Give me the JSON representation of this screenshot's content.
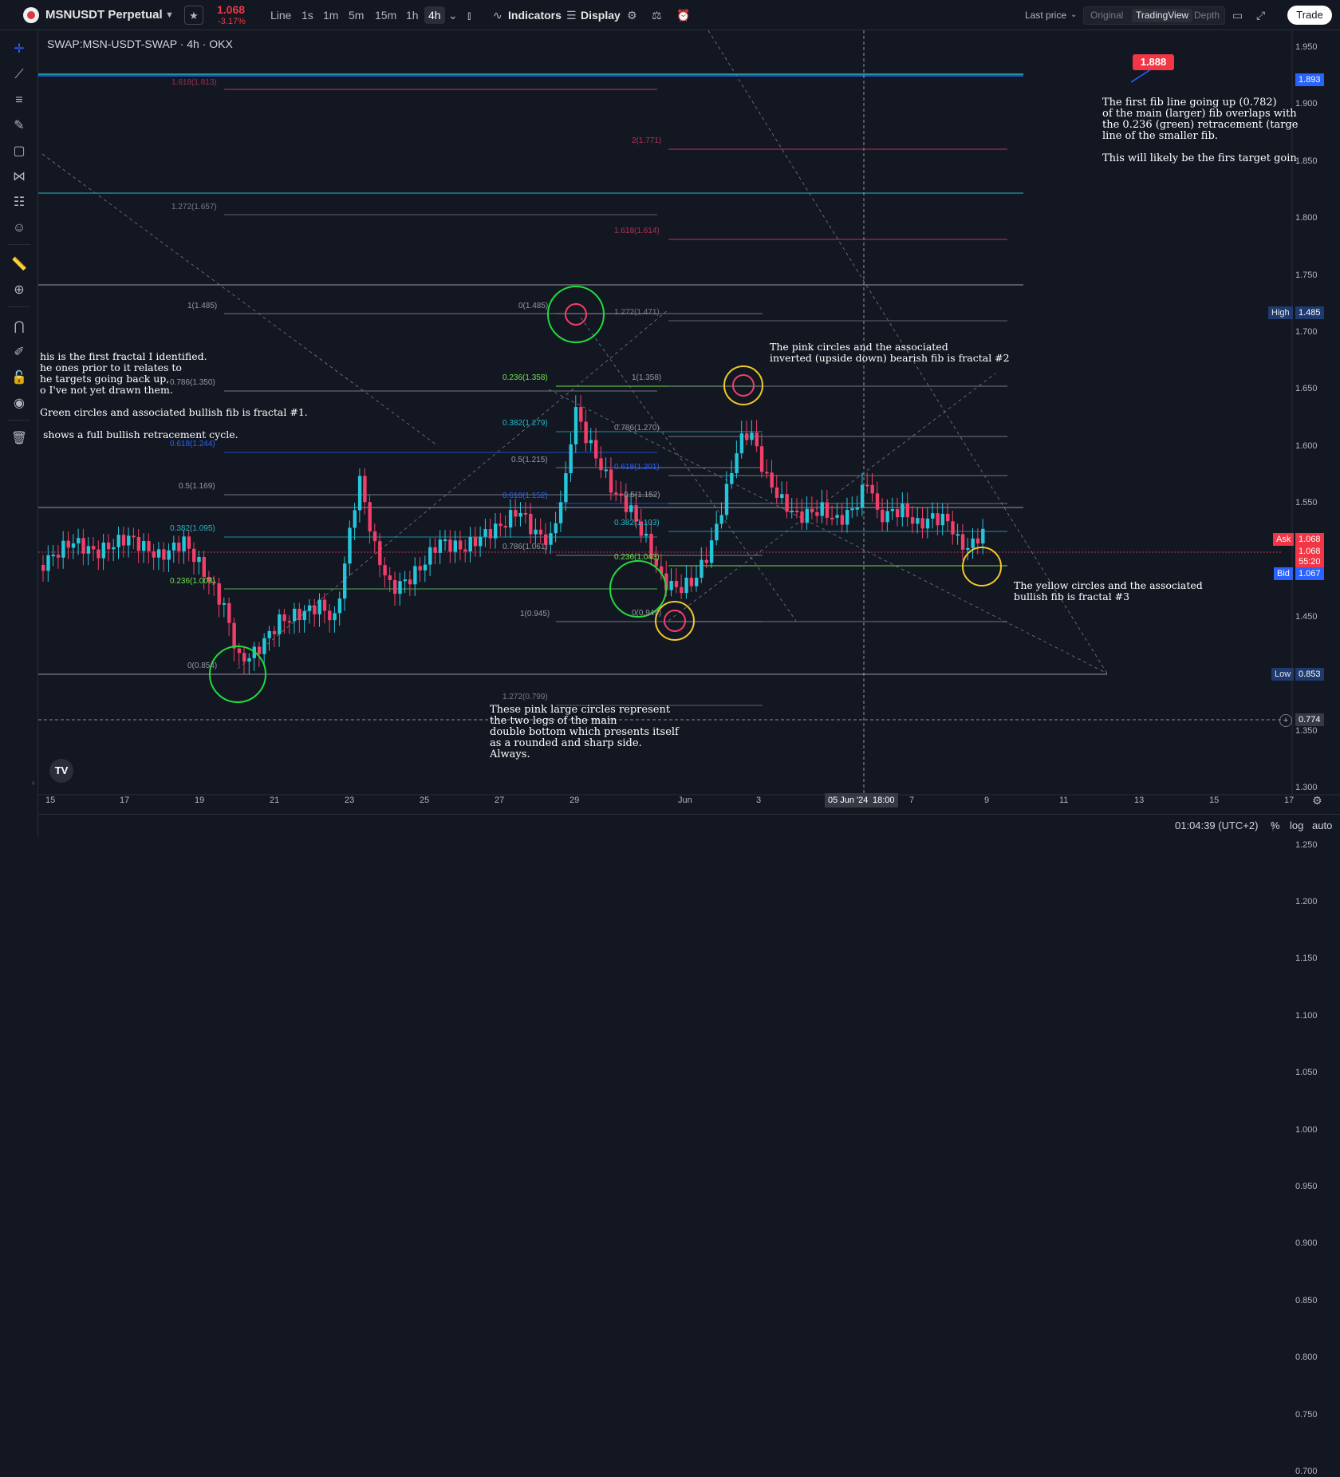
{
  "header": {
    "symbol": "MSNUSDT Perpetual",
    "price": "1.068",
    "change": "-3.17%",
    "timeframes": [
      "Line",
      "1s",
      "1m",
      "5m",
      "15m",
      "1h",
      "4h"
    ],
    "active_timeframe": "4h",
    "indicators_label": "Indicators",
    "display_label": "Display",
    "last_price_label": "Last price",
    "views": [
      "Original",
      "TradingView",
      "Depth"
    ],
    "active_view": "TradingView",
    "trade_label": "Trade"
  },
  "chart": {
    "title": "SWAP:MSN-USDT-SWAP · 4h · OKX",
    "y_ticks": [
      "1.950",
      "1.900",
      "1.850",
      "1.800",
      "1.750",
      "1.700",
      "1.650",
      "1.600",
      "1.550",
      "1.500",
      "1.450",
      "1.400",
      "1.350",
      "1.300",
      "1.250",
      "1.200",
      "1.150",
      "1.100",
      "1.050",
      "1.000",
      "0.950",
      "0.900",
      "0.850",
      "0.800",
      "0.750",
      "0.700"
    ],
    "x_ticks": [
      "15",
      "17",
      "19",
      "21",
      "23",
      "25",
      "27",
      "29",
      "Jun",
      "3",
      "7",
      "9",
      "11",
      "13",
      "15",
      "17"
    ],
    "crosshair_date": "05 Jun '24",
    "crosshair_time": "18:00",
    "price_tags": {
      "line": "1.893",
      "high_label": "High",
      "high": "1.485",
      "ask_label": "Ask",
      "ask": "1.068",
      "last": "1.068",
      "countdown": "55:20",
      "bid_label": "Bid",
      "bid": "1.067",
      "low_label": "Low",
      "low": "0.853",
      "crosshair_price": "0.774"
    },
    "target_marker": "1.888",
    "fib_labels": {
      "a1": "1.618(1.813)",
      "a2": "1.272(1.657)",
      "a3": "1(1.485)",
      "a4": "0.786(1.350)",
      "a5": "0.618(1.244)",
      "a6": "0.5(1.169)",
      "a7": "0.382(1.095)",
      "a8": "0.236(1.003)",
      "a9": "0(0.854)",
      "b1": "0(1.485)",
      "b2": "0.236(1.358)",
      "b3": "0.382(1.279)",
      "b4": "0.5(1.215)",
      "b5": "0.618(1.152)",
      "b6": "0.786(1.061)",
      "b7": "1(0.945)",
      "b8": "1.272(0.799)",
      "c1": "2(1.771)",
      "c2": "1.618(1.614)",
      "c3": "1.272(1.471)",
      "c4": "1(1.358)",
      "c5": "0.786(1.270)",
      "c6": "0.618(1.201)",
      "c7": "0.5(1.152)",
      "c8": "0.382(1.103)",
      "c9": "0.236(1.043)",
      "c10": "0(0.945)"
    },
    "annotations": {
      "fractal1": "his is the first fractal I identified.\nhe ones prior to it relates to\nhe targets going back up,\no I've not yet drawn them.\n\nGreen circles and associated bullish fib is fractal #1.\n\n shows a full bullish retracement cycle.",
      "fractal2": "The pink circles and the associated\ninverted (upside down) bearish fib is fractal #2",
      "fractal3": "The yellow circles and the associated\nbullish fib is fractal #3",
      "target": "The first fib line going up (0.782)\nof the main (larger) fib overlaps with\nthe 0.236 (green) retracement (targe\nline of the smaller fib.\n\nThis will likely be the firs target goin",
      "double_bottom": "These pink large circles represent\nthe two legs of the main\ndouble bottom which presents itself\nas a rounded and sharp side.\nAlways."
    },
    "colors": {
      "up": "#26c6da",
      "down": "#f23f6a",
      "bg": "#131722"
    }
  },
  "footer": {
    "time": "01:04:39 (UTC+2)",
    "percent": "%",
    "log": "log",
    "auto": "auto"
  }
}
